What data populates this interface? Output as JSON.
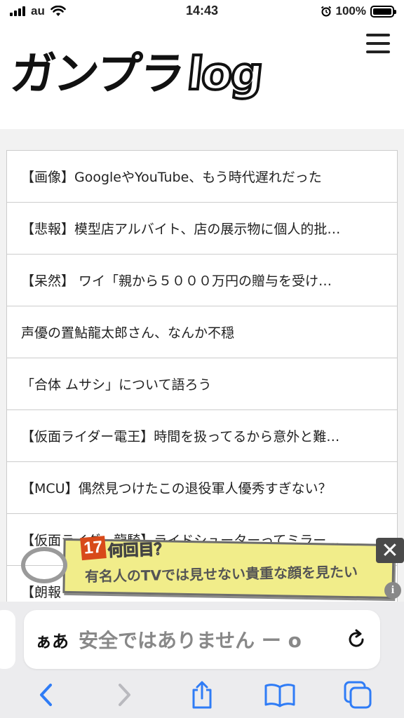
{
  "status": {
    "carrier": "au",
    "time": "14:43",
    "battery": "100%",
    "battery_level": 1.0
  },
  "site": {
    "logo_main": "ガンプラ",
    "logo_suffix": "log"
  },
  "articles": [
    {
      "title": "【画像】GoogleやYouTube、もう時代遅れだった"
    },
    {
      "title": "【悲報】模型店アルバイト、店の展示物に個人的批…"
    },
    {
      "title": "【呆然】 ワイ「親から５０００万円の贈与を受け…"
    },
    {
      "title": "声優の置鮎龍太郎さん、なんか不穏"
    },
    {
      "title": "「合体 ムサシ」について語ろう"
    },
    {
      "title": "【仮面ライダー電王】時間を扱ってるから意外と難…"
    },
    {
      "title": "【MCU】偶然見つけたこの退役軍人優秀すぎない？"
    },
    {
      "title": "【仮面ライダー龍騎】ライドシューターってミラー…"
    },
    {
      "title": "【朗報"
    }
  ],
  "ad": {
    "number": "17",
    "title": "何回目？",
    "subtitle": "有名人のTVでは見せない貴重な顔を見たい",
    "close_symbol": "✕",
    "info_symbol": "i"
  },
  "browser": {
    "aa_label": "ぁあ",
    "address_text": "安全ではありません ー o"
  },
  "colors": {
    "accent": "#2f7cf6",
    "disabled": "#b9b9be"
  }
}
